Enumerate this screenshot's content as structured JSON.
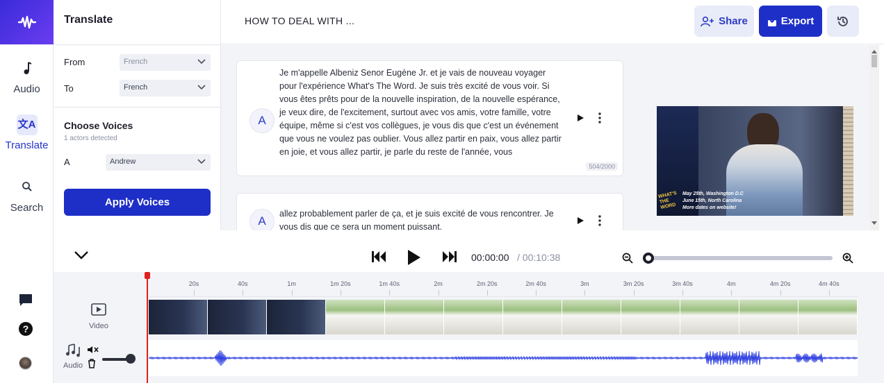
{
  "rail": {
    "items": [
      {
        "label": "Audio",
        "icon": "music-note-icon"
      },
      {
        "label": "Translate",
        "icon": "translate-icon"
      },
      {
        "label": "Search",
        "icon": "search-icon"
      }
    ],
    "bottom_icons": [
      "chat-icon",
      "help-icon",
      "avatar"
    ]
  },
  "panel": {
    "title": "Translate",
    "from_label": "From",
    "from_value": "French",
    "to_label": "To",
    "to_value": "French",
    "voices_title": "Choose Voices",
    "voices_sub": "1 actors detected",
    "actor_label": "A",
    "actor_voice": "Andrew",
    "apply_label": "Apply Voices"
  },
  "header": {
    "title": "HOW TO DEAL WITH ...",
    "share_label": "Share",
    "export_label": "Export"
  },
  "transcript": [
    {
      "actor": "A",
      "text": "Je m'appelle Albeniz Senor Eugène Jr. et je vais de nouveau voyager pour l'expérience What's The Word. Je suis très excité de vous voir. Si vous êtes prêts pour de la nouvelle inspiration, de la nouvelle espérance, je veux dire, de l'excitement, surtout avec vos amis, votre famille, votre équipe, même si c'est vos collègues, je vous dis que c'est un événement que vous ne voulez pas oublier. Vous allez partir en paix, vous allez partir en joie, et vous allez partir, je parle du reste de l'année, vous",
      "count": "504/2000"
    },
    {
      "actor": "A",
      "text": "allez probablement parler de ça, et je suis excité de vous rencontrer. Je vous dis que ce sera un moment puissant.",
      "count": ""
    }
  ],
  "video_overlay": {
    "logo": "WHAT'S THE WORD",
    "line1": "May 25th, Washington D.C",
    "line2": "June 15th, North Carolina",
    "line3": "More dates on website!"
  },
  "player": {
    "time_current": "00:00:00",
    "time_total": "/ 00:10:38",
    "zoom_level": 0.0
  },
  "timeline": {
    "ticks": [
      "20s",
      "40s",
      "1m",
      "1m 20s",
      "1m 40s",
      "2m",
      "2m 20s",
      "2m 40s",
      "3m",
      "3m 20s",
      "3m 40s",
      "4m",
      "4m 20s",
      "4m 40s"
    ],
    "video_label": "Video",
    "audio_label": "Audio",
    "volume": 0.9
  },
  "colors": {
    "accent": "#1e2fc7",
    "playhead": "#e0201a",
    "waveform": "#2a3be0"
  }
}
